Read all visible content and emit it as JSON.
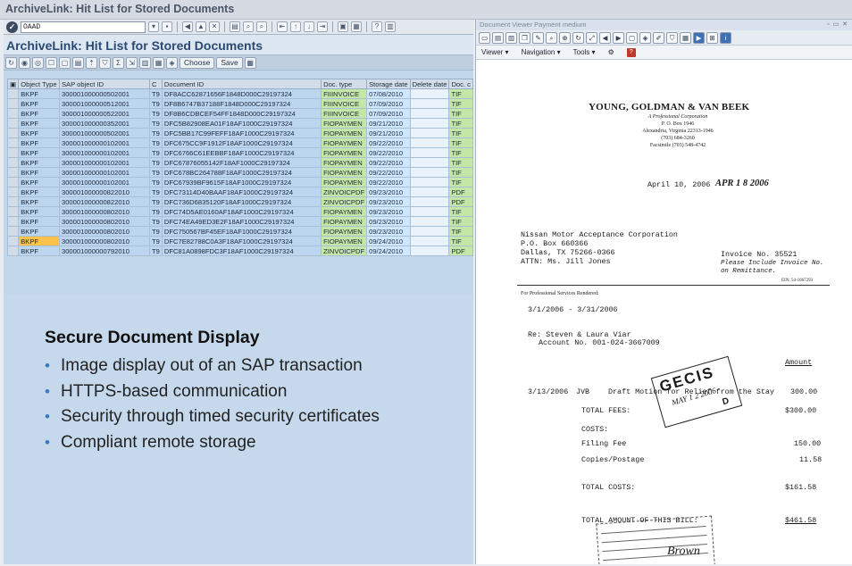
{
  "top_title": "ArchiveLink: Hit List for Stored Documents",
  "sap": {
    "command_field": "OAAD",
    "title": "ArchiveLink: Hit List for Stored Documents",
    "app_toolbar": {
      "choose_label": "Choose",
      "save_label": "Save"
    },
    "columns": [
      "Object Type",
      "SAP object ID",
      "C",
      "Document ID",
      "Doc. type",
      "Storage date",
      "Delete date",
      "Doc. c"
    ],
    "rows": [
      [
        "BKPF",
        "300001000000502001",
        "T9",
        "DF8ACC62871656F1848D000C29197324",
        "FIIINVOICE",
        "07/08/2010",
        "",
        "TIF"
      ],
      [
        "BKPF",
        "300001000000512001",
        "T9",
        "DF8B6747B37188F1848D000C29197324",
        "FIIINVOICE",
        "07/09/2010",
        "",
        "TIF"
      ],
      [
        "BKPF",
        "300001000000522001",
        "T9",
        "DF8B6CDBCEF54FF1848D000C29197324",
        "FIIINVOICE",
        "07/09/2010",
        "",
        "TIF"
      ],
      [
        "BKPF",
        "300001000000352001",
        "T9",
        "DFC5B82908EA01F18AF1000C29197324",
        "FIOPAYMEN",
        "09/21/2010",
        "",
        "TIF"
      ],
      [
        "BKPF",
        "300001000000502001",
        "T9",
        "DFC5BB17C99FEFF18AF1000C29197324",
        "FIOPAYMEN",
        "09/21/2010",
        "",
        "TIF"
      ],
      [
        "BKPF",
        "300001000000102001",
        "T9",
        "DFC675CC9F1912F18AF1000C29197324",
        "FIOPAYMEN",
        "09/22/2010",
        "",
        "TIF"
      ],
      [
        "BKPF",
        "300001000000102001",
        "T9",
        "DFC6766C61EEBBF18AF1000C29197324",
        "FIOPAYMEN",
        "09/22/2010",
        "",
        "TIF"
      ],
      [
        "BKPF",
        "300001000000102001",
        "T9",
        "DFC67876055142F18AF1000C29197324",
        "FIOPAYMEN",
        "09/22/2010",
        "",
        "TIF"
      ],
      [
        "BKPF",
        "300001000000102001",
        "T9",
        "DFC678BC264788F18AF1000C29197324",
        "FIOPAYMEN",
        "09/22/2010",
        "",
        "TIF"
      ],
      [
        "BKPF",
        "300001000000102001",
        "T9",
        "DFC67939BF9615F18AF1000C29197324",
        "FIOPAYMEN",
        "09/22/2010",
        "",
        "TIF"
      ],
      [
        "BKPF",
        "300001000000822010",
        "T9",
        "DFC73114D40BAAF18AF1000C29197324",
        "ZINVOICPDF",
        "09/23/2010",
        "",
        "PDF"
      ],
      [
        "BKPF",
        "300001000000822010",
        "T9",
        "DFC736D6835120F18AF1000C29197324",
        "ZINVOICPDF",
        "09/23/2010",
        "",
        "PDF"
      ],
      [
        "BKPF",
        "300001000000802010",
        "T9",
        "DFC74D5AE0160AF18AF1000C29197324",
        "FIOPAYMEN",
        "09/23/2010",
        "",
        "TIF"
      ],
      [
        "BKPF",
        "300001000000802010",
        "T9",
        "DFC74EA49ED3E2F18AF1000C29197324",
        "FIOPAYMEN",
        "09/23/2010",
        "",
        "TIF"
      ],
      [
        "BKPF",
        "300001000000802010",
        "T9",
        "DFC750567BF45EF18AF1000C29197324",
        "FIOPAYMEN",
        "09/23/2010",
        "",
        "TIF"
      ],
      [
        "BKPF",
        "300001000000802010",
        "T9",
        "DFC7E82788C0A3F18AF1000C29197324",
        "FIOPAYMEN",
        "09/24/2010",
        "",
        "TIF"
      ],
      [
        "BKPF",
        "300001000000792010",
        "T9",
        "DFC81A0898FDC3F18AF1000C29197324",
        "ZINVOICPDF",
        "09/24/2010",
        "",
        "PDF"
      ]
    ],
    "highlighted_row": 15
  },
  "panel": {
    "heading": "Secure Document Display",
    "bullets": [
      "Image display out of an SAP transaction",
      "HTTPS-based communication",
      "Security through timed security certificates",
      "Compliant remote storage"
    ]
  },
  "viewer": {
    "title": "Document Viewer  Payment medium",
    "menu": [
      "Viewer",
      "Navigation",
      "Tools"
    ],
    "doc": {
      "firm": "YOUNG, GOLDMAN & VAN BEEK",
      "firm_lines": [
        "A Professional Corporation",
        "P. O. Box 1946",
        "Alexandria, Virginia 22313-1946",
        "(703) 684-3260",
        "Facsimile (703) 548-4742"
      ],
      "date": "April 10, 2006",
      "received": "APR 1 8 2006",
      "address": [
        "Nissan Motor Acceptance Corporation",
        "P.O. Box 660366",
        "Dallas, TX 75266-0366",
        "ATTN:  Ms. Jill Jones"
      ],
      "invoice_no": "Invoice No. 35521",
      "invoice_note_1": "Please Include Invoice No.",
      "invoice_note_2": "on Remittance.",
      "ein": "EIN: 54-1667293",
      "services_label": "For Professional Services Rendered:",
      "period": "3/1/2006  -  3/31/2006",
      "re_line": "Re: Steven & Laura Viar",
      "account": "Account No. 001-024-3667009",
      "amount_header": "Amount",
      "entry_date": "3/13/2006",
      "entry_initials": "JVB",
      "entry_desc": "Draft Motion for Relief from the Stay",
      "entry_amount": "300.00",
      "total_fees_label": "TOTAL FEES:",
      "total_fees": "$300.00",
      "costs_label": "COSTS:",
      "filing_fee_label": "Filing Fee",
      "filing_fee": "150.00",
      "copies_label": "Copies/Postage",
      "copies": "11.58",
      "total_costs_label": "TOTAL COSTS:",
      "total_costs": "$161.58",
      "total_bill_label": "TOTAL AMOUNT OF THIS BILL:",
      "total_bill": "$461.58",
      "stamp_main": "GECIS",
      "stamp_date": "MAY 1 2 2006",
      "stamp_letter": "D",
      "signature": "Brown"
    }
  }
}
